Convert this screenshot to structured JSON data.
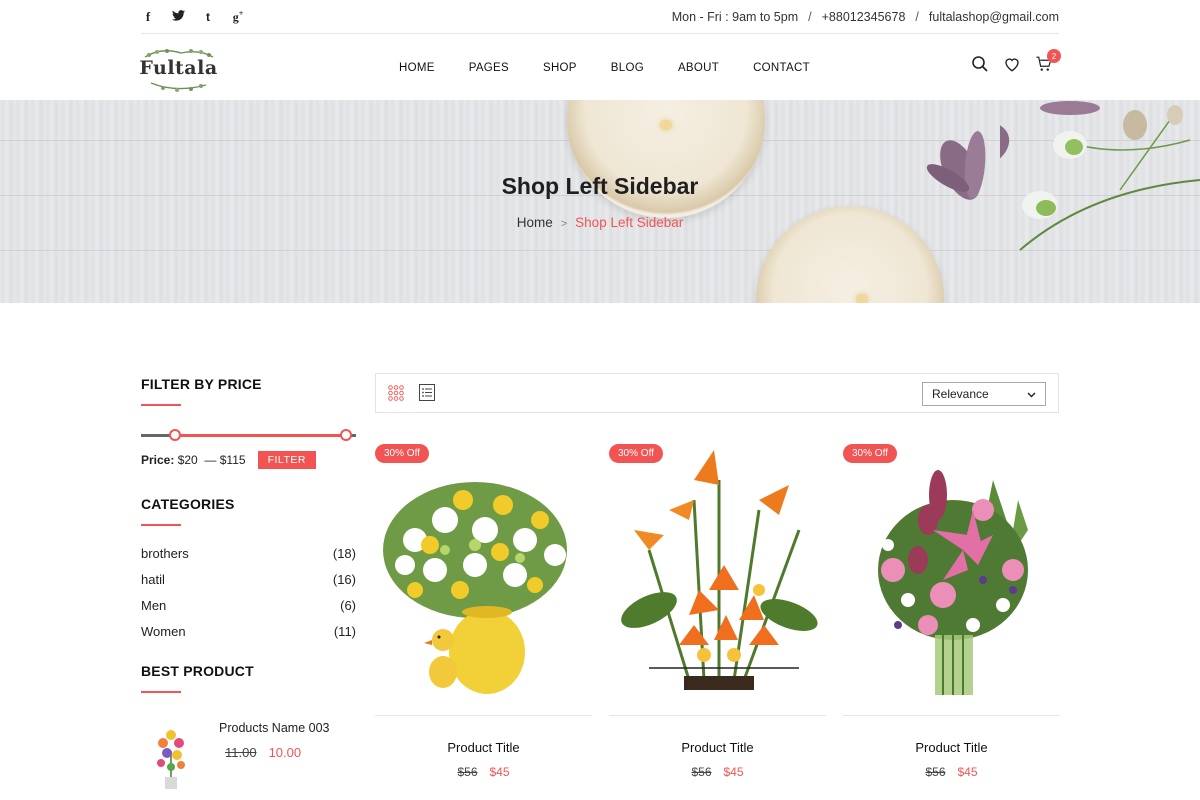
{
  "topbar": {
    "social": [
      {
        "icon": "facebook-icon",
        "glyph": "f"
      },
      {
        "icon": "twitter-icon",
        "glyph": "t"
      },
      {
        "icon": "tumblr-icon",
        "glyph": "t"
      },
      {
        "icon": "google-plus-icon",
        "glyph": "g+"
      }
    ],
    "hours": "Mon - Fri : 9am to 5pm",
    "phone": "+88012345678",
    "email": "fultalashop@gmail.com",
    "separator": "/"
  },
  "header": {
    "logo_text": "Fultala",
    "nav": [
      "HOME",
      "PAGES",
      "SHOP",
      "BLOG",
      "ABOUT",
      "CONTACT"
    ],
    "cart_count": "2",
    "icons": [
      "search-icon",
      "heart-icon",
      "cart-icon"
    ]
  },
  "hero": {
    "title": "Shop Left Sidebar",
    "breadcrumb_home": "Home",
    "breadcrumb_arrow": ">",
    "breadcrumb_current": "Shop Left Sidebar"
  },
  "sidebar": {
    "price_title": "FILTER BY PRICE",
    "price_label": "Price:",
    "price_min": "$20",
    "price_dash": "—",
    "price_max": "$115",
    "filter_label": "FILTER",
    "categories_title": "CATEGORIES",
    "categories": [
      {
        "name": "brothers",
        "count": "(18)"
      },
      {
        "name": "hatil",
        "count": "(16)"
      },
      {
        "name": "Men",
        "count": "(6)"
      },
      {
        "name": "Women",
        "count": "(11)"
      }
    ],
    "best_title": "BEST PRODUCT",
    "best": {
      "name": "Products Name 003",
      "old_price": "11.00",
      "new_price": "10.00"
    }
  },
  "toolbar": {
    "sort_selected": "Relevance",
    "view_modes": [
      "grid-view-icon",
      "list-view-icon"
    ]
  },
  "products": [
    {
      "badge": "30% Off",
      "title": "Product Title",
      "old_price": "$56",
      "new_price": "$45"
    },
    {
      "badge": "30% Off",
      "title": "Product Title",
      "old_price": "$56",
      "new_price": "$45"
    },
    {
      "badge": "30% Off",
      "title": "Product Title",
      "old_price": "$56",
      "new_price": "$45"
    }
  ],
  "colors": {
    "accent": "#f25454",
    "text": "#222222",
    "border": "#e3e3e3"
  }
}
